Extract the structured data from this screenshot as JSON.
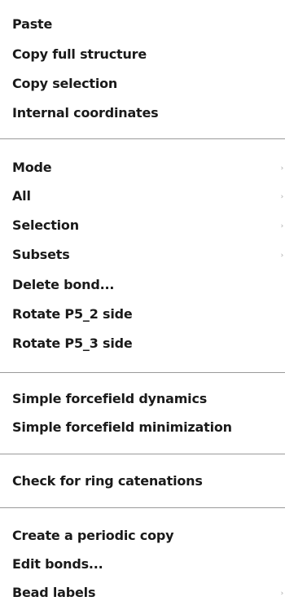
{
  "menu": {
    "items": [
      {
        "label": "Paste"
      },
      {
        "label": "Copy full structure"
      },
      {
        "label": "Copy selection"
      },
      {
        "label": "Internal coordinates"
      },
      {
        "label": "Mode"
      },
      {
        "label": "All"
      },
      {
        "label": "Selection"
      },
      {
        "label": "Subsets"
      },
      {
        "label": "Delete bond..."
      },
      {
        "label": "Rotate P5_2 side"
      },
      {
        "label": "Rotate P5_3 side"
      },
      {
        "label": "Simple forcefield dynamics"
      },
      {
        "label": "Simple forcefield minimization"
      },
      {
        "label": "Check for ring catenations"
      },
      {
        "label": "Create a periodic copy"
      },
      {
        "label": "Edit bonds..."
      },
      {
        "label": "Bead labels"
      }
    ],
    "submenu_arrow": "›"
  }
}
